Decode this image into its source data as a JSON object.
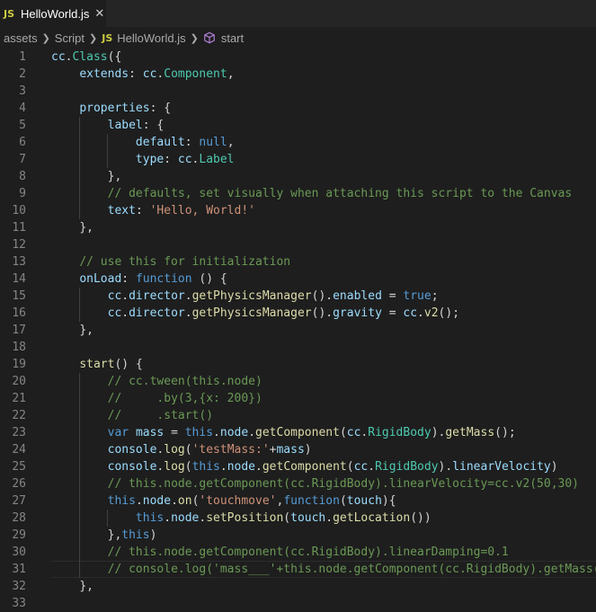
{
  "tab": {
    "badge": "JS",
    "title": "HelloWorld.js",
    "close": "✕"
  },
  "breadcrumb": {
    "items": [
      "assets",
      "Script",
      "HelloWorld.js",
      "start"
    ],
    "js_badge": "JS",
    "sep": "❯"
  },
  "colors": {
    "keyword": "#569cd6",
    "string": "#ce9178",
    "comment": "#6a9955",
    "property": "#9cdcfe",
    "function": "#dcdcaa",
    "class": "#4ec9b0",
    "plain": "#d4d4d4",
    "bracket": "#ffd700"
  },
  "editor": {
    "line_numbers": [
      "1",
      "2",
      "3",
      "4",
      "5",
      "6",
      "7",
      "8",
      "9",
      "10",
      "11",
      "12",
      "13",
      "14",
      "15",
      "16",
      "17",
      "18",
      "19",
      "20",
      "21",
      "22",
      "23",
      "24",
      "25",
      "26",
      "27",
      "28",
      "29",
      "30",
      "31",
      "32",
      "33"
    ],
    "lines": [
      "cc.Class({",
      "    extends: cc.Component,",
      "",
      "    properties: {",
      "        label: {",
      "            default: null,",
      "            type: cc.Label",
      "        },",
      "        // defaults, set visually when attaching this script to the Canvas",
      "        text: 'Hello, World!'",
      "    },",
      "",
      "    // use this for initialization",
      "    onLoad: function () {",
      "        cc.director.getPhysicsManager().enabled = true;",
      "        cc.director.getPhysicsManager().gravity = cc.v2();",
      "    },",
      "",
      "    start() {",
      "        // cc.tween(this.node)",
      "        //     .by(3,{x: 200})",
      "        //     .start()",
      "        var mass = this.node.getComponent(cc.RigidBody).getMass();",
      "        console.log('testMass:'+mass)",
      "        console.log(this.node.getComponent(cc.RigidBody).linearVelocity)",
      "        // this.node.getComponent(cc.RigidBody).linearVelocity=cc.v2(50,30)",
      "        this.node.on('touchmove',function(touch){",
      "            this.node.setPosition(touch.getLocation())",
      "        },this)",
      "        // this.node.getComponent(cc.RigidBody).linearDamping=0.1",
      "        // console.log('mass___'+this.node.getComponent(cc.RigidBody).getMass()",
      "    },",
      ""
    ]
  }
}
